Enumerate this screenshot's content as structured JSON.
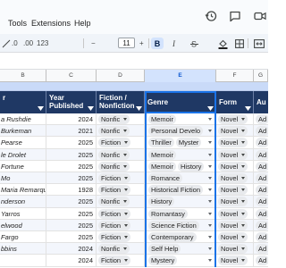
{
  "menu": {
    "items": [
      {
        "label": "Tools"
      },
      {
        "label": "Extensions"
      },
      {
        "label": "Help"
      }
    ]
  },
  "toolbar": {
    "zoom_like": ".0",
    "decimals": ".00",
    "format_number": "123",
    "font_size": "11",
    "minus": "−",
    "plus": "+",
    "bold": "B"
  },
  "columns": {
    "letters": [
      "B",
      "C",
      "D",
      "E",
      "F",
      "G"
    ],
    "selected": "E"
  },
  "table": {
    "headers": {
      "author": "r",
      "year": "Year Published",
      "fiction": "Fiction / Nonfiction",
      "genre": "Genre",
      "form": "Form",
      "audience": "Au"
    },
    "rows": [
      {
        "author": "a Rushdie",
        "year": "2024",
        "fiction": "Nonfic",
        "genres": [
          "Memoir"
        ],
        "form": "Novel",
        "aud": "Ad"
      },
      {
        "author": "Burkeman",
        "year": "2021",
        "fiction": "Nonfic",
        "genres": [
          "Personal Develo"
        ],
        "form": "Novel",
        "aud": "Ad"
      },
      {
        "author": "Pearse",
        "year": "2025",
        "fiction": "Fiction",
        "genres": [
          "Thriller",
          "Myster"
        ],
        "form": "Novel",
        "aud": "Ad"
      },
      {
        "author": "le Drolet",
        "year": "2025",
        "fiction": "Nonfic",
        "genres": [
          "Memoir"
        ],
        "form": "Novel",
        "aud": "Ad"
      },
      {
        "author": "Fortune",
        "year": "2025",
        "fiction": "Nonfic",
        "genres": [
          "Memoir",
          "History"
        ],
        "form": "Novel",
        "aud": "Ad"
      },
      {
        "author": "Mo",
        "year": "2025",
        "fiction": "Fiction",
        "genres": [
          "Romance"
        ],
        "form": "Novel",
        "aud": "Ad"
      },
      {
        "author": "Maria Remarque",
        "year": "1928",
        "fiction": "Fiction",
        "genres": [
          "Historical Fiction"
        ],
        "form": "Novel",
        "aud": "Ad"
      },
      {
        "author": "nderson",
        "year": "2025",
        "fiction": "Nonfic",
        "genres": [
          "History"
        ],
        "form": "Novel",
        "aud": "Ad"
      },
      {
        "author": "Yarros",
        "year": "2025",
        "fiction": "Fiction",
        "genres": [
          "Romantasy"
        ],
        "form": "Novel",
        "aud": "Ad"
      },
      {
        "author": "elwood",
        "year": "2025",
        "fiction": "Fiction",
        "genres": [
          "Science Fiction"
        ],
        "form": "Novel",
        "aud": "Ad"
      },
      {
        "author": "Fargo",
        "year": "2025",
        "fiction": "Fiction",
        "genres": [
          "Contemporary"
        ],
        "form": "Novel",
        "aud": "Ad"
      },
      {
        "author": "bbins",
        "year": "2024",
        "fiction": "Nonfic",
        "genres": [
          "Self Help"
        ],
        "form": "Novel",
        "aud": "Ad"
      },
      {
        "author": "",
        "year": "2024",
        "fiction": "Fiction",
        "genres": [
          "Mystery"
        ],
        "form": "Novel",
        "aud": "Ad"
      }
    ]
  },
  "colors": {
    "header_bg": "#1f3864",
    "band": "#c9daf8",
    "selection": "#1a73e8",
    "chip": "#e8eaed"
  },
  "icons": [
    "history-icon",
    "comment-icon",
    "meet-icon",
    "undo-icon",
    "redo-icon",
    "print-icon",
    "paint-format-icon",
    "fill-color-icon",
    "borders-icon",
    "merge-icon"
  ]
}
